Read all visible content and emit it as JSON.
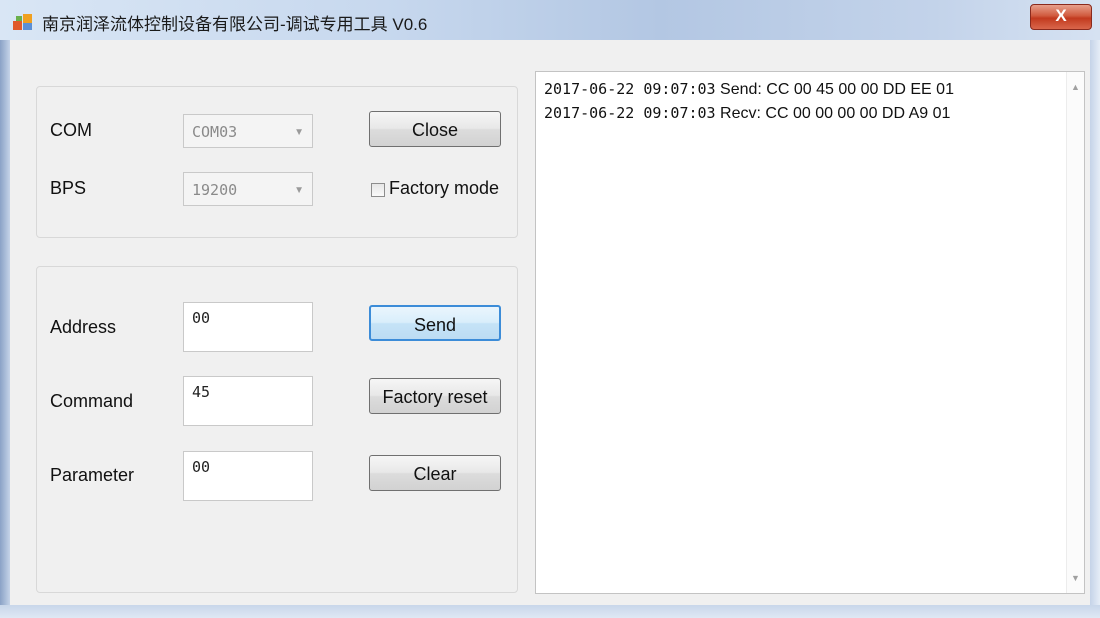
{
  "window": {
    "title": "南京润泽流体控制设备有限公司-调试专用工具 V0.6",
    "close_glyph": "X"
  },
  "connection": {
    "com_label": "COM",
    "com_value": "COM03",
    "bps_label": "BPS",
    "bps_value": "19200",
    "close_button": "Close",
    "factory_mode_label": "Factory mode",
    "factory_mode_checked": false
  },
  "command": {
    "address_label": "Address",
    "address_value": "00",
    "command_label": "Command",
    "command_value": "45",
    "parameter_label": "Parameter",
    "parameter_value": "00",
    "send_button": "Send",
    "factory_reset_button": "Factory reset",
    "clear_button": "Clear"
  },
  "log": {
    "lines": [
      {
        "timestamp": "2017-06-22 09:07:03",
        "text": "Send: CC 00 45 00 00 DD EE 01"
      },
      {
        "timestamp": "2017-06-22 09:07:03",
        "text": "Recv: CC 00 00 00 00 DD A9 01"
      }
    ]
  },
  "icons": {
    "app_icon": "app-icon",
    "dropdown_arrow": "chevron-down-icon",
    "scroll_up": "scroll-up-icon",
    "scroll_down": "scroll-down-icon"
  },
  "colors": {
    "close_button_red": "#c23a1f",
    "focus_blue": "#3c8cd8"
  }
}
